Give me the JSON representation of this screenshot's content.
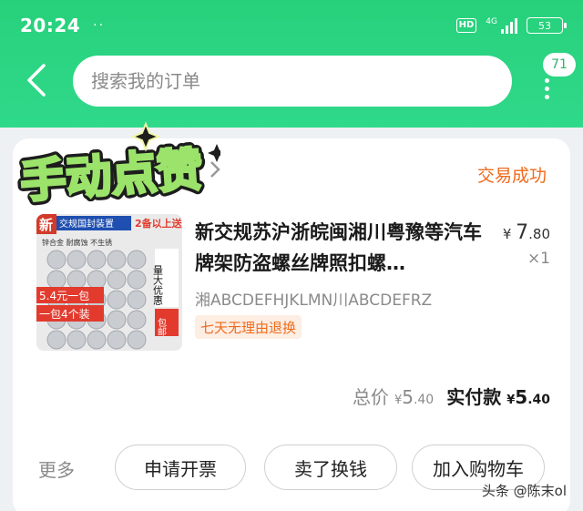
{
  "status_bar": {
    "time": "20:24",
    "dots": "··",
    "hd": "HD",
    "network": "4G",
    "battery": "53"
  },
  "header": {
    "search_placeholder": "搜索我的订单",
    "message_count": "71"
  },
  "order": {
    "sticker_text": "手动点赞",
    "status": "交易成功",
    "product": {
      "title": "新交规苏沪浙皖闽湘川粤豫等汽车牌架防盗螺丝牌照扣螺…",
      "sku": "湘ABCDEFHJKLMN川ABCDEFRZ",
      "tag": "七天无理由退换",
      "price_symbol": "¥",
      "price_int": "7",
      "price_dec": ".80",
      "quantity": "×1",
      "image_texts": {
        "badge_new": "新",
        "banner": "交规国封装置",
        "promo": "2备以上送",
        "sub": "锌合金  耐腐蚀  不生锈",
        "side": "量大优惠",
        "deal1": "5.4元一包",
        "deal2": "一包4个装",
        "free": "包邮"
      }
    },
    "totals": {
      "total_label": "总价",
      "total_symbol": "¥",
      "total_int": "5",
      "total_dec": ".40",
      "paid_label": "实付款",
      "paid_symbol": "¥",
      "paid_int": "5",
      "paid_dec": ".40"
    },
    "actions": {
      "more": "更多",
      "invoice": "申请开票",
      "resell": "卖了换钱",
      "add_to_cart": "加入购物车"
    }
  },
  "watermark": "头条 @陈末ol",
  "colors": {
    "brand_green": "#2fd98a",
    "status_orange": "#f06b1c",
    "background": "#eef1f4"
  }
}
